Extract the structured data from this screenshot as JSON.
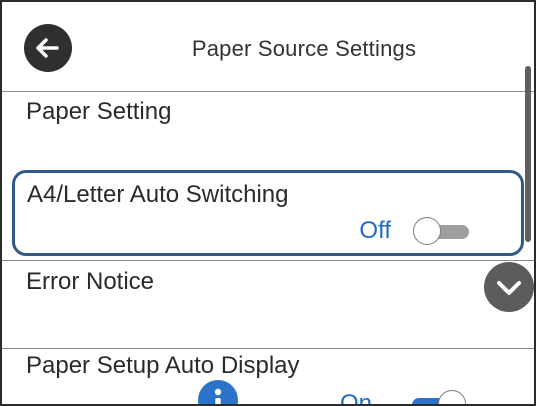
{
  "header": {
    "title": "Paper Source Settings",
    "back_icon": "back-arrow-icon"
  },
  "settings": {
    "paper_setting": {
      "label": "Paper Setting"
    },
    "auto_switching": {
      "label": "A4/Letter Auto Switching",
      "value": "Off",
      "enabled": false
    },
    "error_notice": {
      "label": "Error Notice"
    },
    "auto_display": {
      "label": "Paper Setup Auto Display",
      "value": "On",
      "enabled": true,
      "info_icon": "info-icon"
    }
  },
  "controls": {
    "scroll_down_icon": "chevron-down-icon"
  },
  "colors": {
    "selection_border": "#2f5a87",
    "value_text": "#1f6bc4",
    "toggle_on": "#2a73c9",
    "toggle_off": "#9e9e9e"
  }
}
